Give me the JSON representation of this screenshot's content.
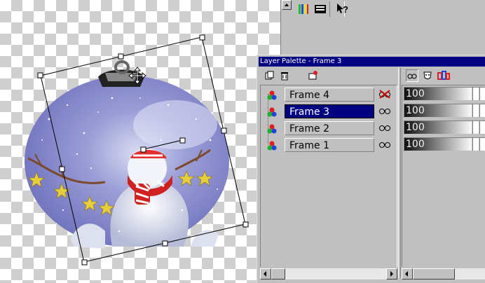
{
  "palette": {
    "title": "Layer Palette - Frame 3",
    "layers": [
      {
        "name": "Frame 4",
        "visible": false,
        "opacity": "100",
        "selected": false
      },
      {
        "name": "Frame 3",
        "visible": true,
        "opacity": "100",
        "selected": true
      },
      {
        "name": "Frame 2",
        "visible": true,
        "opacity": "100",
        "selected": false
      },
      {
        "name": "Frame 1",
        "visible": true,
        "opacity": "100",
        "selected": false
      }
    ],
    "icons": {
      "new_layer": "new-layer-icon",
      "delete_layer": "trash-icon",
      "layer_properties": "layer-properties-icon",
      "visible": "glasses-icon",
      "hidden": "glasses-crossed-icon",
      "layer_type": "rgb-layer-icon"
    },
    "colors": {
      "title_bar": "#000080",
      "selected_row": "#000080",
      "hidden_mark": "#cc0000"
    }
  },
  "toolbar": {
    "icons": [
      "color-palette-icon",
      "histogram-icon",
      "help-context-icon"
    ],
    "help_label": "?"
  }
}
